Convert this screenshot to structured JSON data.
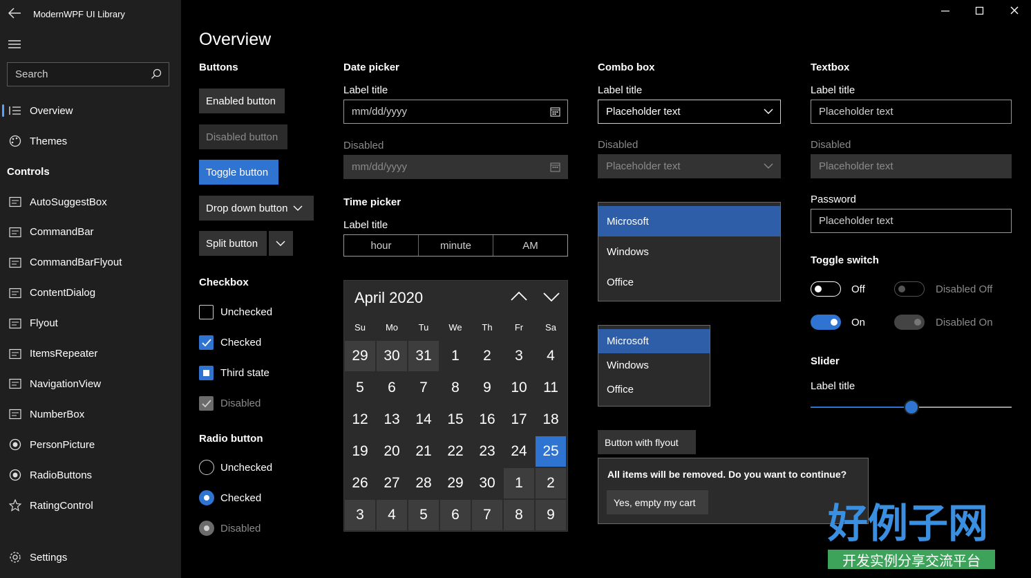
{
  "app": {
    "title": "ModernWPF UI Library"
  },
  "window": {
    "minimize": "—",
    "maximize": "☐",
    "close": "✕"
  },
  "sidebar": {
    "search_placeholder": "Search",
    "items_top": [
      {
        "label": "Overview",
        "icon": "list-icon",
        "selected": true
      },
      {
        "label": "Themes",
        "icon": "palette-icon"
      }
    ],
    "controls_header": "Controls",
    "controls": [
      {
        "label": "AutoSuggestBox",
        "icon": "autosuggest-icon"
      },
      {
        "label": "CommandBar",
        "icon": "commandbar-icon"
      },
      {
        "label": "CommandBarFlyout",
        "icon": "commandbarflyout-icon"
      },
      {
        "label": "ContentDialog",
        "icon": "contentdialog-icon"
      },
      {
        "label": "Flyout",
        "icon": "flyout-icon"
      },
      {
        "label": "ItemsRepeater",
        "icon": "itemsrepeater-icon"
      },
      {
        "label": "NavigationView",
        "icon": "navigationview-icon"
      },
      {
        "label": "NumberBox",
        "icon": "numberbox-icon"
      },
      {
        "label": "PersonPicture",
        "icon": "personpicture-icon"
      },
      {
        "label": "RadioButtons",
        "icon": "radiobuttons-icon"
      },
      {
        "label": "RatingControl",
        "icon": "star-icon"
      }
    ],
    "settings": "Settings"
  },
  "main": {
    "title": "Overview",
    "buttons": {
      "header": "Buttons",
      "enabled": "Enabled button",
      "disabled": "Disabled button",
      "toggle": "Toggle button",
      "dropdown": "Drop down button",
      "split": "Split button"
    },
    "checkbox": {
      "header": "Checkbox",
      "items": [
        "Unchecked",
        "Checked",
        "Third state",
        "Disabled"
      ]
    },
    "radio": {
      "header": "Radio button",
      "items": [
        "Unchecked",
        "Checked",
        "Disabled"
      ]
    },
    "datepicker": {
      "header": "Date picker",
      "label": "Label title",
      "placeholder": "mm/dd/yyyy",
      "disabled_label": "Disabled",
      "disabled_placeholder": "mm/dd/yyyy"
    },
    "timepicker": {
      "header": "Time picker",
      "label": "Label title",
      "hour": "hour",
      "minute": "minute",
      "ampm": "AM"
    },
    "calendar": {
      "month": "April 2020",
      "dow": [
        "Su",
        "Mo",
        "Tu",
        "We",
        "Th",
        "Fr",
        "Sa"
      ],
      "days": [
        [
          "29",
          "30",
          "31",
          "1",
          "2",
          "3",
          "4"
        ],
        [
          "5",
          "6",
          "7",
          "8",
          "9",
          "10",
          "11"
        ],
        [
          "12",
          "13",
          "14",
          "15",
          "16",
          "17",
          "18"
        ],
        [
          "19",
          "20",
          "21",
          "22",
          "23",
          "24",
          "25"
        ],
        [
          "26",
          "27",
          "28",
          "29",
          "30",
          "1",
          "2"
        ],
        [
          "3",
          "4",
          "5",
          "6",
          "7",
          "8",
          "9"
        ]
      ],
      "selected_day": "25"
    },
    "combobox": {
      "header": "Combo box",
      "label": "Label title",
      "placeholder": "Placeholder text",
      "disabled_label": "Disabled",
      "disabled_placeholder": "Placeholder text",
      "list1": [
        "Microsoft",
        "Windows",
        "Office"
      ],
      "list2": [
        "Microsoft",
        "Windows",
        "Office"
      ]
    },
    "flyout": {
      "button": "Button with flyout",
      "message": "All items will be removed. Do you want to continue?",
      "confirm": "Yes, empty my cart"
    },
    "textbox": {
      "header": "Textbox",
      "label": "Label title",
      "placeholder": "Placeholder text",
      "disabled_label": "Disabled",
      "disabled_placeholder": "Placeholder text",
      "password_label": "Password",
      "password_placeholder": "Placeholder text"
    },
    "toggle": {
      "header": "Toggle switch",
      "off": "Off",
      "on": "On",
      "disabled_off": "Disabled Off",
      "disabled_on": "Disabled On"
    },
    "slider": {
      "header": "Slider",
      "label": "Label title",
      "value_percent": 50
    }
  },
  "watermark": {
    "main": "好例子网",
    "sub": "开发实例分享交流平台"
  },
  "colors": {
    "accent": "#2f74d0",
    "sidebar": "#1f1f1f",
    "surface": "#2b2b2b"
  }
}
